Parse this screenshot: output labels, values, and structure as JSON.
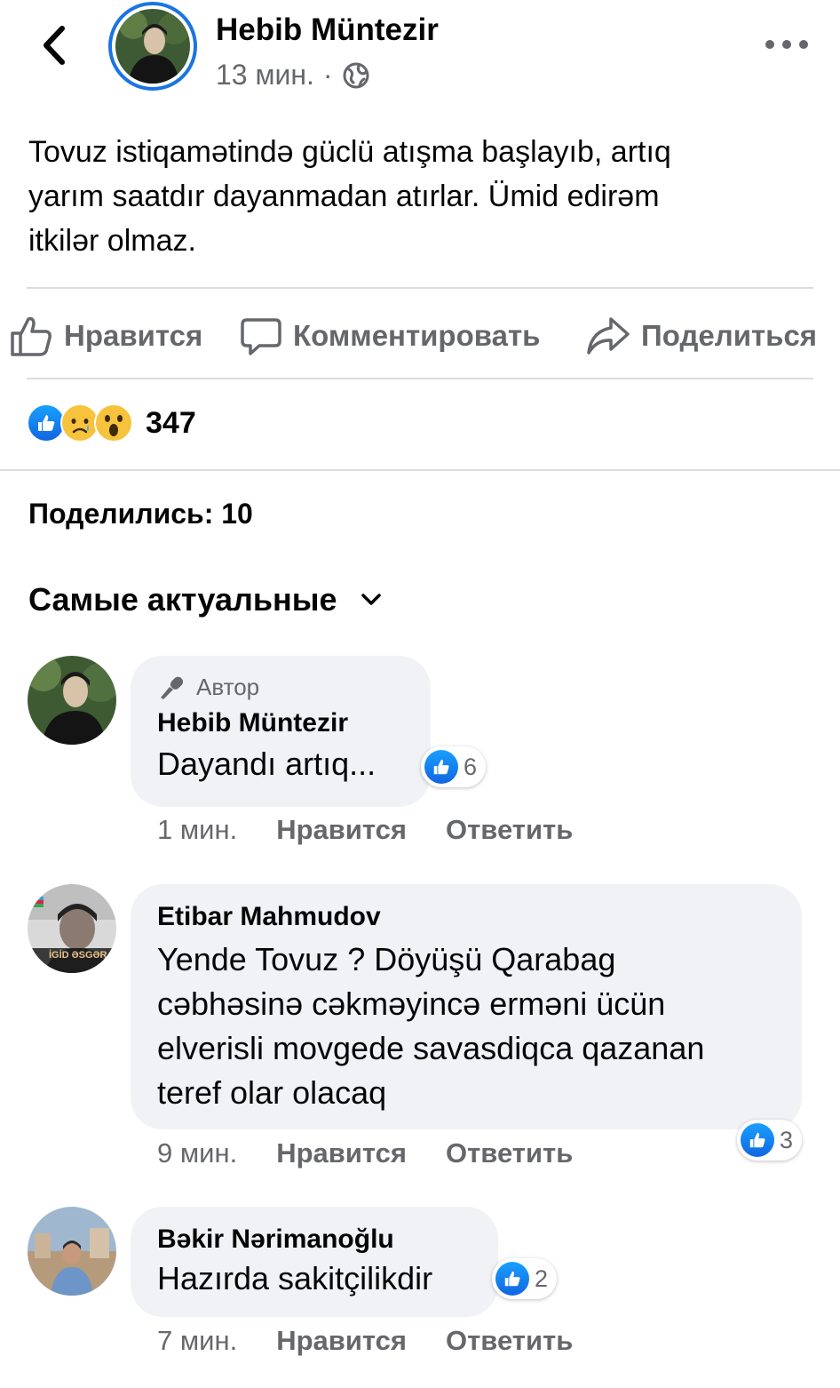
{
  "header": {
    "author": "Hebib Müntezir",
    "time": "13 мин.",
    "separator": "·",
    "audience_icon": "globe-icon",
    "back_icon": "chevron-left-icon",
    "more_icon": "ellipsis-icon"
  },
  "post": {
    "lines": [
      "Tovuz istiqamətində güclü atışma başlayıb, artıq",
      "yarım saatdır dayanmadan atırlar. Ümid edirəm",
      "itkilər olmaz."
    ]
  },
  "actions": {
    "like": "Нравится",
    "comment": "Комментировать",
    "share": "Поделиться"
  },
  "reactions": {
    "types": [
      "like",
      "sad",
      "wow"
    ],
    "count": "347"
  },
  "shares_label": "Поделились: 10",
  "sort_label": "Самые актуальные",
  "comments": [
    {
      "author_tag": "Автор",
      "name": "Hebib Müntezir",
      "lines": [
        "Dayandı artıq..."
      ],
      "likes": "6",
      "time": "1 мин.",
      "like_label": "Нравится",
      "reply_label": "Ответить"
    },
    {
      "name": "Etibar Mahmudov",
      "lines": [
        "Yende Tovuz ? Döyüşü Qarabag",
        "cəbhəsinə cəkməyincə erməni ücün",
        "elverisli movgede savasdiqca qazanan",
        "teref  olar olacaq"
      ],
      "likes": "3",
      "time": "9 мин.",
      "like_label": "Нравится",
      "reply_label": "Ответить",
      "avatar_caption": "İGİD ƏSGƏR"
    },
    {
      "name": "Bəkir Nərimanoğlu",
      "lines": [
        "Hazırda sakitçilikdir"
      ],
      "likes": "2",
      "time": "7 мин.",
      "like_label": "Нравится",
      "reply_label": "Ответить"
    }
  ],
  "colors": {
    "accent": "#1b74e4",
    "text_secondary": "#65676b",
    "bubble": "#f0f2f5"
  }
}
